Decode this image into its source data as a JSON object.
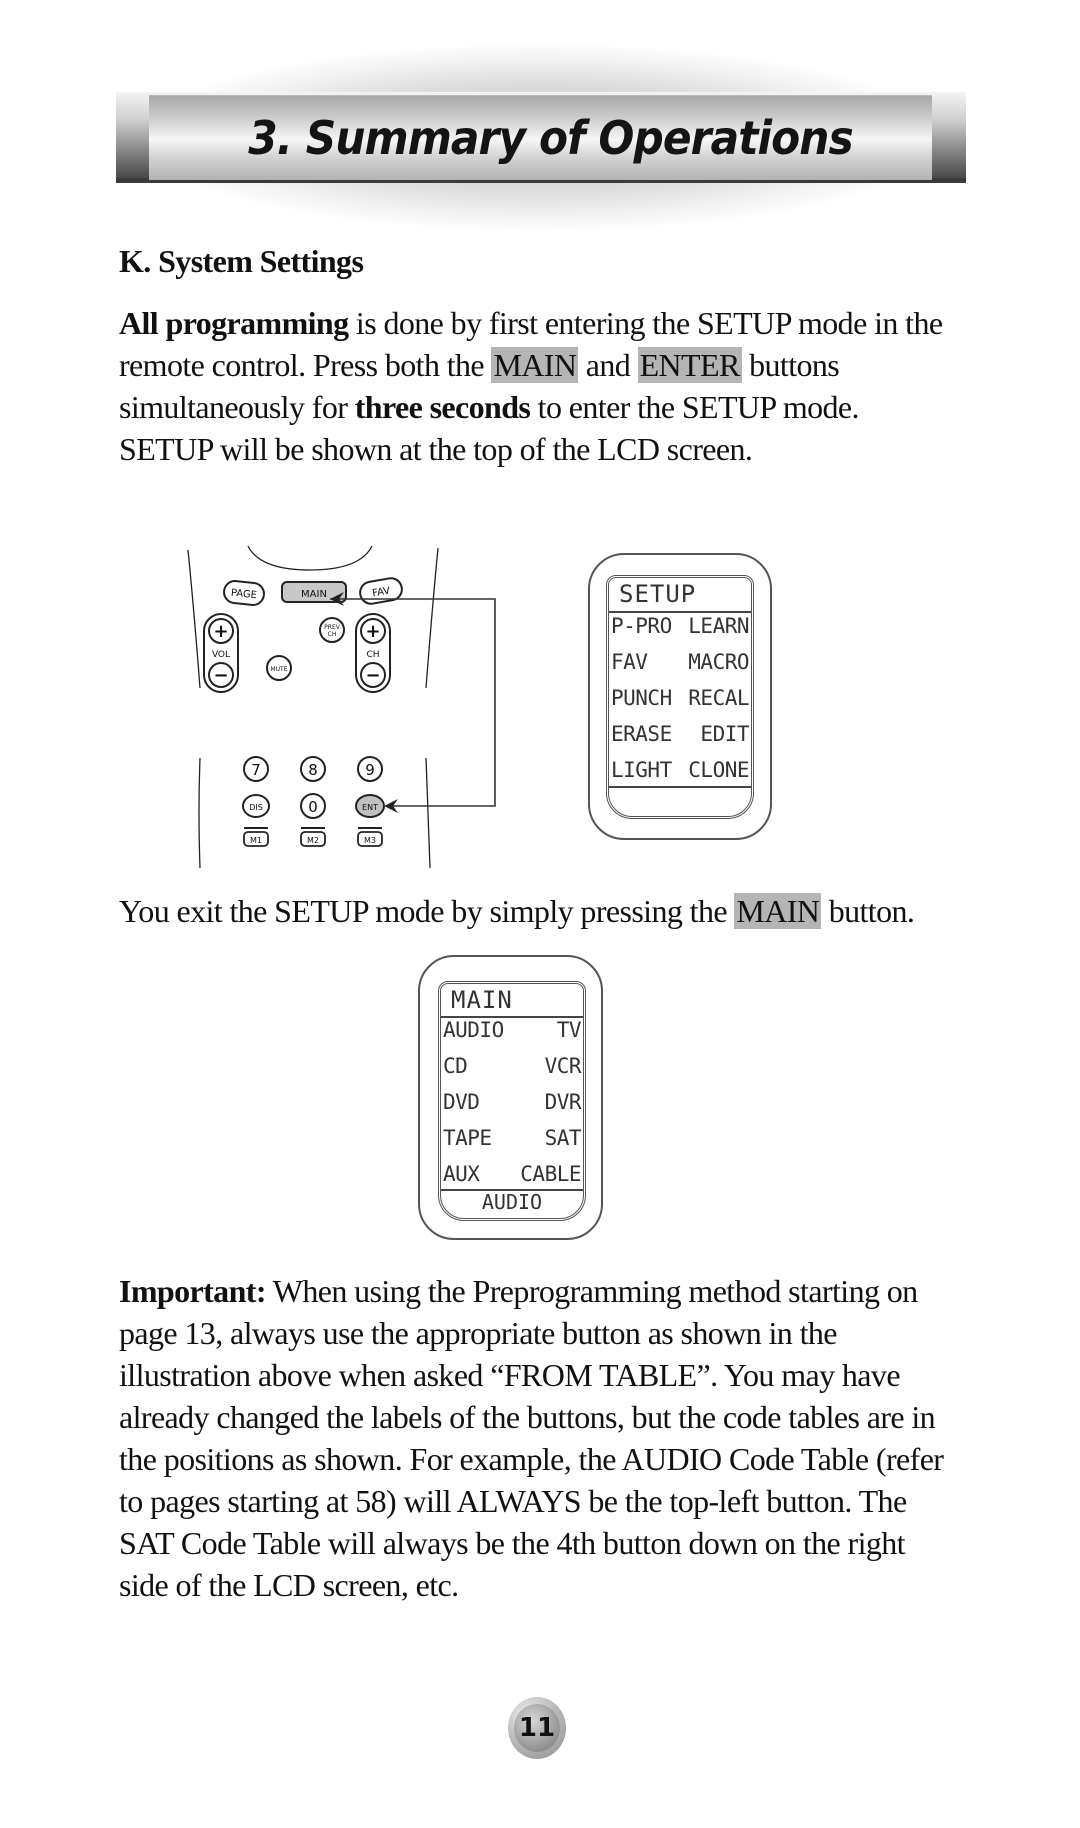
{
  "banner": {
    "title": "3. Summary of Operations"
  },
  "section": {
    "heading": "K. System Settings"
  },
  "para1": {
    "bold_lead": "All programming",
    "t1": " is done by first entering the SETUP mode in the remote control. Press both the ",
    "hl_main": "MAIN",
    "t2": " and ",
    "hl_enter": "ENTER",
    "t3": " buttons simultaneously for ",
    "bold_mid": "three seconds",
    "t4": " to enter the SETUP mode.  SETUP will be shown at the top of the LCD screen."
  },
  "remote": {
    "top_buttons": [
      "PAGE",
      "MAIN",
      "FAV"
    ],
    "vol_label": "VOL",
    "ch_label": "CH",
    "plus": "+",
    "minus": "−",
    "prev_ch": [
      "PREV",
      "CH"
    ],
    "mute": "MUTE",
    "digits": [
      "7",
      "8",
      "9"
    ],
    "row2": [
      "DIS",
      "0",
      "ENT"
    ],
    "macros": [
      "M1",
      "M2",
      "M3"
    ],
    "highlight_color": "#c8c8c8"
  },
  "setup_lcd": {
    "title": "SETUP",
    "rows": [
      [
        "P-PRO",
        "LEARN"
      ],
      [
        "FAV",
        "MACRO"
      ],
      [
        "PUNCH",
        "RECAL"
      ],
      [
        "ERASE",
        "EDIT"
      ],
      [
        "LIGHT",
        "CLONE"
      ]
    ]
  },
  "para2": {
    "t1": "You exit the SETUP mode by simply pressing the ",
    "hl_main": "MAIN",
    "t2": " button."
  },
  "main_lcd": {
    "title": "MAIN",
    "rows": [
      [
        "AUDIO",
        "TV"
      ],
      [
        "CD",
        "VCR"
      ],
      [
        "DVD",
        "DVR"
      ],
      [
        "TAPE",
        "SAT"
      ],
      [
        "AUX",
        "CABLE"
      ]
    ],
    "footer": "AUDIO"
  },
  "para3": {
    "bold_lead": "Important:",
    "text": " When using the Preprogramming method starting on page 13, always use the appropriate button as shown in the illustration above when asked “FROM TABLE”. You may have already changed the labels of the buttons, but the code tables are in the positions as shown. For example, the AUDIO Code Table (refer to pages starting at 58) will ALWAYS be the top-left button. The SAT Code Table will always be the 4th button down on the right side of the LCD screen, etc."
  },
  "page": {
    "number": "11"
  }
}
